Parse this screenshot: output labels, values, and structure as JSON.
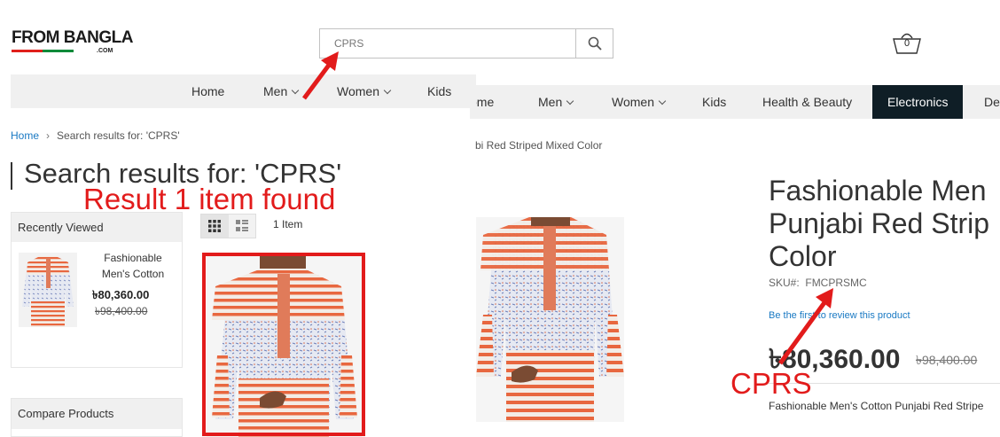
{
  "header": {
    "logo": {
      "text_main": "FROM BANGLA",
      "text_sub": ".COM"
    },
    "search": {
      "value": "CPRS",
      "button": "search-icon"
    },
    "cart": {
      "count": "0",
      "icon": "cart-icon"
    }
  },
  "nav_left": {
    "items": [
      "Home",
      "Men",
      "Women",
      "Kids"
    ]
  },
  "nav_right": {
    "items": [
      "ome",
      "Men",
      "Women",
      "Kids",
      "Health & Beauty",
      "Electronics",
      "De"
    ],
    "active": "Electronics"
  },
  "breadcrumb": {
    "home": "Home",
    "current": "Search results for: 'CPRS'"
  },
  "page_title": "Search results for: 'CPRS'",
  "annotations": {
    "result": "Result 1 item found",
    "cprs": "CPRS"
  },
  "toolbar": {
    "count": "1 Item",
    "modes": [
      "grid-icon",
      "list-icon"
    ]
  },
  "recently_viewed": {
    "title": "Recently Viewed",
    "item": {
      "name": "Fashionable Men's Cotton",
      "price": "৳80,360.00",
      "old_price": "৳98,400.00"
    }
  },
  "compare": {
    "title": "Compare Products"
  },
  "product_page": {
    "breadcrumb": "bi Red Striped Mixed Color",
    "title_lines": [
      "Fashionable Men",
      "Punjabi Red Strip",
      "Color"
    ],
    "sku_label": "SKU#:",
    "sku_value": "FMCPRSMC",
    "review_link": "Be the first to review this product",
    "price": "৳80,360.00",
    "old_price": "৳98,400.00",
    "description": "Fashionable Men's Cotton Punjabi Red Stripe"
  },
  "colors": {
    "accent": "#e21b1b",
    "nav_bg": "#f0f0f0",
    "active_nav": "#0f1e26",
    "link": "#1979c3"
  }
}
